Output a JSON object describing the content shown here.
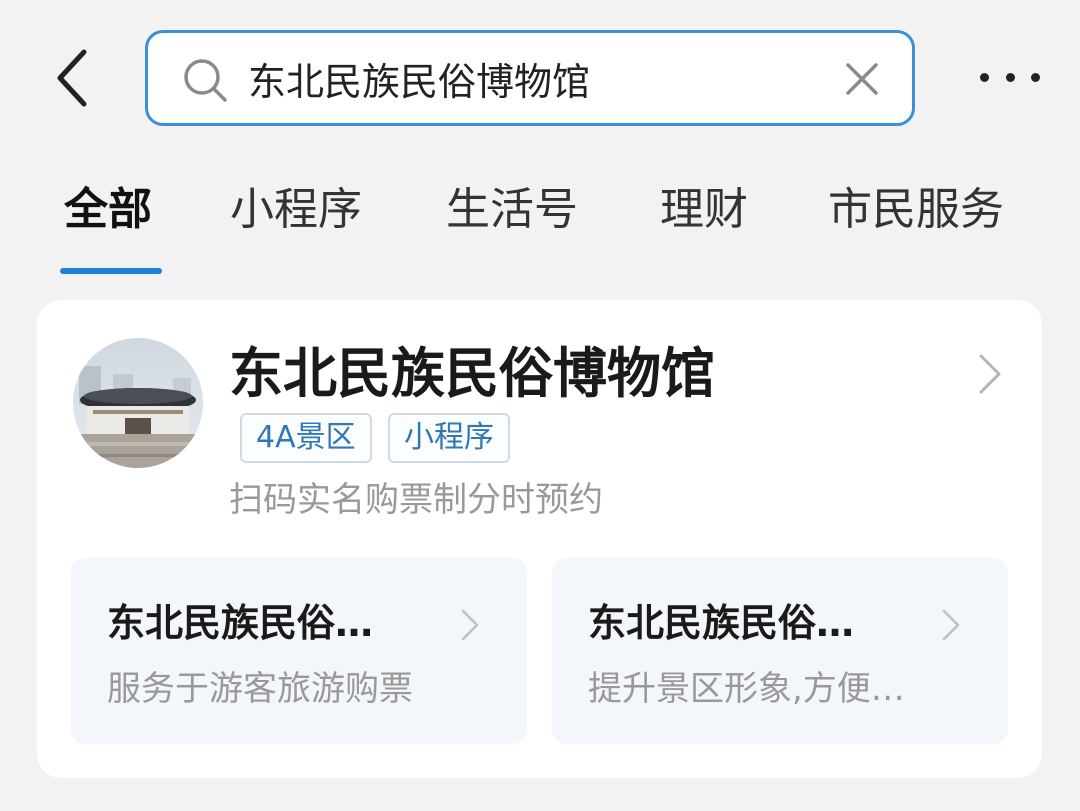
{
  "header": {
    "back_icon": "chevron-left-icon",
    "search": {
      "value": "东北民族民俗博物馆",
      "search_icon": "search-icon",
      "clear_icon": "close-icon"
    },
    "more_icon": "more-dots-icon"
  },
  "tabs": [
    {
      "label": "全部",
      "active": true
    },
    {
      "label": "小程序",
      "active": false
    },
    {
      "label": "生活号",
      "active": false
    },
    {
      "label": "理财",
      "active": false
    },
    {
      "label": "市民服务",
      "active": false
    }
  ],
  "result": {
    "title": "东北民族民俗博物馆",
    "avatar_icon": "museum-photo",
    "tags": [
      "4A景区",
      "小程序"
    ],
    "description": "扫码实名购票制分时预约",
    "entries": [
      {
        "title": "东北民族民俗…",
        "subtitle": "服务于游客旅游购票"
      },
      {
        "title": "东北民族民俗…",
        "subtitle": "提升景区形象,方便…"
      }
    ]
  },
  "colors": {
    "accent": "#1f7fd1",
    "search_border": "#3b8fd6",
    "tag_text": "#2f78b8",
    "muted_text": "#999999",
    "background": "#f2f2f2",
    "card": "#ffffff",
    "sub_card": "#f3f6fb"
  }
}
